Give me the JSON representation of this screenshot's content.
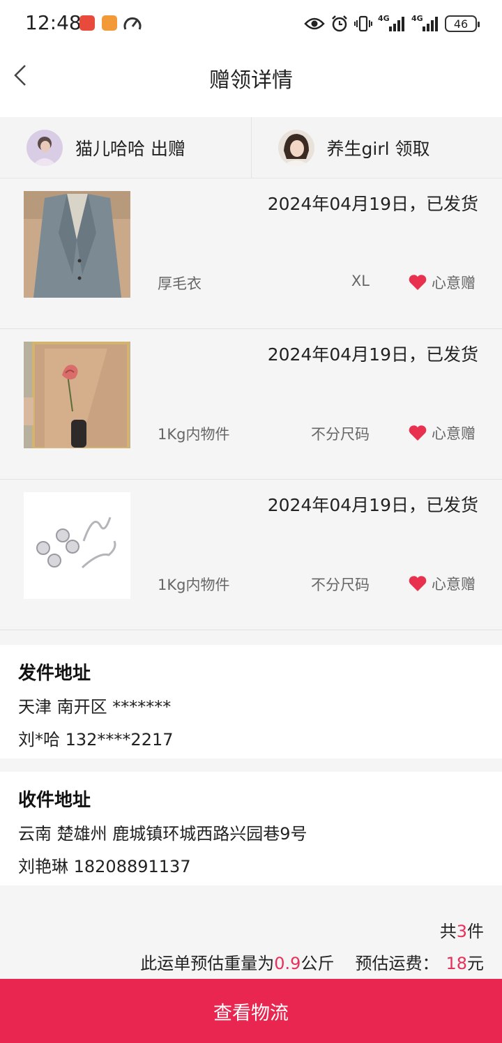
{
  "status_bar": {
    "time": "12:48",
    "battery": "46",
    "icons": [
      "eye-icon",
      "alarm-icon",
      "vibrate-icon",
      "signal-4g-icon",
      "signal-4g-icon"
    ]
  },
  "nav": {
    "title": "赠领详情",
    "back_icon": "chevron-left-icon"
  },
  "parties": {
    "giver": {
      "name": "猫儿哈哈",
      "action": "出赠",
      "text": "猫儿哈哈 出赠"
    },
    "receiver": {
      "name": "养生girl",
      "action": "领取",
      "text": "养生girl 领取"
    }
  },
  "items": [
    {
      "date_status": "2024年04月19日，已发货",
      "name": "厚毛衣",
      "size": "XL",
      "tag": "心意赠",
      "image": "coat-photo"
    },
    {
      "date_status": "2024年04月19日，已发货",
      "name": "1Kg内物件",
      "size": "不分尺码",
      "tag": "心意赠",
      "image": "rose-frame-photo"
    },
    {
      "date_status": "2024年04月19日，已发货",
      "name": "1Kg内物件",
      "size": "不分尺码",
      "tag": "心意赠",
      "image": "hooks-photo"
    }
  ],
  "sender_address": {
    "title": "发件地址",
    "address": "天津 南开区 *******",
    "contact": "刘*哈 132****2217"
  },
  "receiver_address": {
    "title": "收件地址",
    "address": "云南 楚雄州 鹿城镇环城西路兴园巷9号",
    "contact": "刘艳琳 18208891137"
  },
  "summary": {
    "count_prefix": "共",
    "count": "3",
    "count_suffix": "件",
    "weight_prefix": "此运单预估重量为",
    "weight": "0.9",
    "weight_suffix": "公斤",
    "fee_prefix": "预估运费：",
    "fee": "18",
    "fee_suffix": "元"
  },
  "button": {
    "label": "查看物流"
  },
  "colors": {
    "accent": "#e8264f",
    "highlight": "#e8305a",
    "heart": "#e8304f"
  }
}
